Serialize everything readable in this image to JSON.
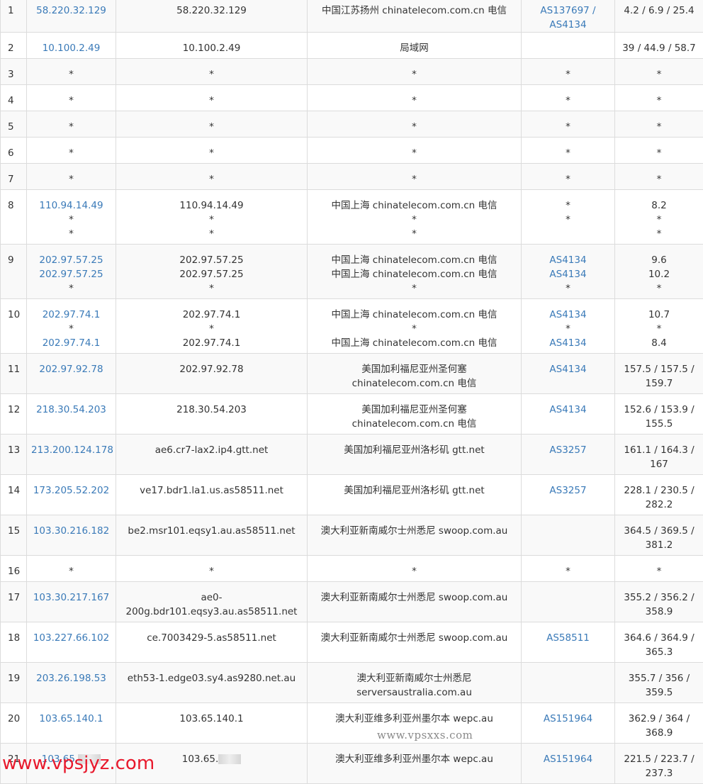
{
  "rows": [
    {
      "hop": "1",
      "ip": [
        "58.220.32.129"
      ],
      "host": [
        "58.220.32.129"
      ],
      "loc": [
        "中国江苏扬州 chinatelecom.com.cn 电信"
      ],
      "asn": [
        "AS137697 / AS4134"
      ],
      "rtt": [
        "4.2 / 6.9 / 25.4"
      ],
      "h": 51
    },
    {
      "hop": "2",
      "ip": [
        "10.100.2.49"
      ],
      "host": [
        "10.100.2.49"
      ],
      "loc": [
        "局域网"
      ],
      "asn": [
        ""
      ],
      "rtt": [
        "39 / 44.9 / 58.7"
      ],
      "h": 37
    },
    {
      "hop": "3",
      "ip": [
        "*"
      ],
      "host": [
        "*"
      ],
      "loc": [
        "*"
      ],
      "asn": [
        "*"
      ],
      "rtt": [
        "*"
      ],
      "h": 37
    },
    {
      "hop": "4",
      "ip": [
        "*"
      ],
      "host": [
        "*"
      ],
      "loc": [
        "*"
      ],
      "asn": [
        "*"
      ],
      "rtt": [
        "*"
      ],
      "h": 37
    },
    {
      "hop": "5",
      "ip": [
        "*"
      ],
      "host": [
        "*"
      ],
      "loc": [
        "*"
      ],
      "asn": [
        "*"
      ],
      "rtt": [
        "*"
      ],
      "h": 37
    },
    {
      "hop": "6",
      "ip": [
        "*"
      ],
      "host": [
        "*"
      ],
      "loc": [
        "*"
      ],
      "asn": [
        "*"
      ],
      "rtt": [
        "*"
      ],
      "h": 37
    },
    {
      "hop": "7",
      "ip": [
        "*"
      ],
      "host": [
        "*"
      ],
      "loc": [
        "*"
      ],
      "asn": [
        "*"
      ],
      "rtt": [
        "*"
      ],
      "h": 37
    },
    {
      "hop": "8",
      "ip": [
        "110.94.14.49",
        "*",
        "*"
      ],
      "host": [
        "110.94.14.49",
        "*",
        "*"
      ],
      "loc": [
        "中国上海 chinatelecom.com.cn 电信",
        "*",
        "*"
      ],
      "asn": [
        "",
        "*",
        "*"
      ],
      "rtt": [
        "8.2",
        "*",
        "*"
      ],
      "h": 77
    },
    {
      "hop": "9",
      "ip": [
        "202.97.57.25",
        "202.97.57.25",
        "*"
      ],
      "host": [
        "202.97.57.25",
        "202.97.57.25",
        "*"
      ],
      "loc": [
        "中国上海 chinatelecom.com.cn 电信",
        "中国上海 chinatelecom.com.cn 电信",
        "*"
      ],
      "asn": [
        "AS4134",
        "AS4134",
        "*"
      ],
      "rtt": [
        "9.6",
        "10.2",
        "*"
      ],
      "h": 77
    },
    {
      "hop": "10",
      "ip": [
        "202.97.74.1",
        "*",
        "202.97.74.1"
      ],
      "host": [
        "202.97.74.1",
        "*",
        "202.97.74.1"
      ],
      "loc": [
        "中国上海 chinatelecom.com.cn 电信",
        "*",
        "中国上海 chinatelecom.com.cn 电信"
      ],
      "asn": [
        "AS4134",
        "*",
        "AS4134"
      ],
      "rtt": [
        "10.7",
        "*",
        "8.4"
      ],
      "h": 77
    },
    {
      "hop": "11",
      "ip": [
        "202.97.92.78"
      ],
      "host": [
        "202.97.92.78"
      ],
      "loc": [
        "美国加利福尼亚州圣何塞 chinatelecom.com.cn 电信"
      ],
      "asn": [
        "AS4134"
      ],
      "rtt": [
        "157.5 / 157.5 / 159.7"
      ],
      "h": 57
    },
    {
      "hop": "12",
      "ip": [
        "218.30.54.203"
      ],
      "host": [
        "218.30.54.203"
      ],
      "loc": [
        "美国加利福尼亚州圣何塞 chinatelecom.com.cn 电信"
      ],
      "asn": [
        "AS4134"
      ],
      "rtt": [
        "152.6 / 153.9 / 155.5"
      ],
      "h": 57
    },
    {
      "hop": "13",
      "ip": [
        "213.200.124.178"
      ],
      "host": [
        "ae6.cr7-lax2.ip4.gtt.net"
      ],
      "loc": [
        "美国加利福尼亚州洛杉矶 gtt.net"
      ],
      "asn": [
        "AS3257"
      ],
      "rtt": [
        "161.1 / 164.3 / 167"
      ],
      "h": 57
    },
    {
      "hop": "14",
      "ip": [
        "173.205.52.202"
      ],
      "host": [
        "ve17.bdr1.la1.us.as58511.net"
      ],
      "loc": [
        "美国加利福尼亚州洛杉矶 gtt.net"
      ],
      "asn": [
        "AS3257"
      ],
      "rtt": [
        "228.1 / 230.5 / 282.2"
      ],
      "h": 57
    },
    {
      "hop": "15",
      "ip": [
        "103.30.216.182"
      ],
      "host": [
        "be2.msr101.eqsy1.au.as58511.net"
      ],
      "loc": [
        "澳大利亚新南威尔士州悉尼 swoop.com.au"
      ],
      "asn": [
        ""
      ],
      "rtt": [
        "364.5 / 369.5 / 381.2"
      ],
      "h": 57
    },
    {
      "hop": "16",
      "ip": [
        "*"
      ],
      "host": [
        "*"
      ],
      "loc": [
        "*"
      ],
      "asn": [
        "*"
      ],
      "rtt": [
        "*"
      ],
      "h": 37
    },
    {
      "hop": "17",
      "ip": [
        "103.30.217.167"
      ],
      "host": [
        "ae0-200g.bdr101.eqsy3.au.as58511.net"
      ],
      "loc": [
        "澳大利亚新南威尔士州悉尼 swoop.com.au"
      ],
      "asn": [
        ""
      ],
      "rtt": [
        "355.2 / 356.2 / 358.9"
      ],
      "h": 57
    },
    {
      "hop": "18",
      "ip": [
        "103.227.66.102"
      ],
      "host": [
        "ce.7003429-5.as58511.net"
      ],
      "loc": [
        "澳大利亚新南威尔士州悉尼 swoop.com.au"
      ],
      "asn": [
        "AS58511"
      ],
      "rtt": [
        "364.6 / 364.9 / 365.3"
      ],
      "h": 57
    },
    {
      "hop": "19",
      "ip": [
        "203.26.198.53"
      ],
      "host": [
        "eth53-1.edge03.sy4.as9280.net.au"
      ],
      "loc": [
        "澳大利亚新南威尔士州悉尼 serversaustralia.com.au"
      ],
      "asn": [
        ""
      ],
      "rtt": [
        "355.7 / 356 / 359.5"
      ],
      "h": 57
    },
    {
      "hop": "20",
      "ip": [
        "103.65.140.1"
      ],
      "host": [
        "103.65.140.1"
      ],
      "loc": [
        "澳大利亚维多利亚州墨尔本 wepc.au"
      ],
      "asn": [
        "AS151964"
      ],
      "rtt": [
        "362.9 / 364 / 368.9"
      ],
      "h": 57
    },
    {
      "hop": "21",
      "ip": [
        "103.65.█"
      ],
      "host": [
        "103.65.█"
      ],
      "loc": [
        "澳大利亚维多利亚州墨尔本 wepc.au"
      ],
      "asn": [
        "AS151964"
      ],
      "rtt": [
        "221.5 / 223.7 / 237.3"
      ],
      "h": 57
    }
  ],
  "watermark_center": "www.vpsxxs.com",
  "watermark_corner": "www.vpsjyz.com"
}
